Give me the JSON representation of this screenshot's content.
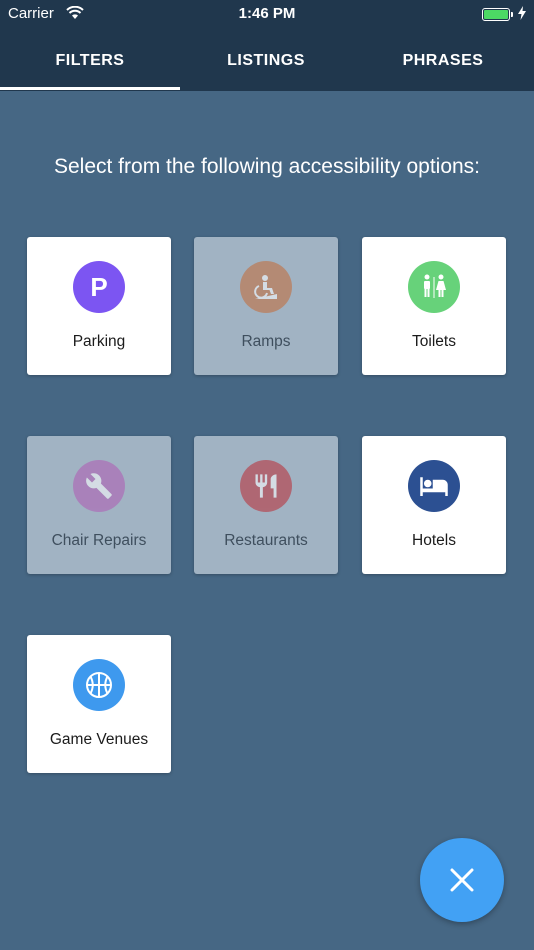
{
  "status_bar": {
    "carrier": "Carrier",
    "time": "1:46 PM"
  },
  "tabs": [
    {
      "label": "FILTERS",
      "active": true
    },
    {
      "label": "LISTINGS",
      "active": false
    },
    {
      "label": "PHRASES",
      "active": false
    }
  ],
  "heading": "Select from the following accessibility options:",
  "filters": [
    {
      "label": "Parking",
      "icon": "parking-icon",
      "color": "#7c55f2",
      "selected": true
    },
    {
      "label": "Ramps",
      "icon": "ramp-icon",
      "color": "#c56a35",
      "selected": false
    },
    {
      "label": "Toilets",
      "icon": "toilets-icon",
      "color": "#67d27a",
      "selected": true
    },
    {
      "label": "Chair Repairs",
      "icon": "wrench-icon",
      "color": "#b05ab4",
      "selected": false
    },
    {
      "label": "Restaurants",
      "icon": "restaurant-icon",
      "color": "#bb2a33",
      "selected": false
    },
    {
      "label": "Hotels",
      "icon": "bed-icon",
      "color": "#2c5092",
      "selected": true
    },
    {
      "label": "Game Venues",
      "icon": "basketball-icon",
      "color": "#3e99ee",
      "selected": true
    }
  ],
  "fab": {
    "icon": "close-icon",
    "color": "#42a1f4"
  },
  "colors": {
    "background": "#466784",
    "header": "#20374d",
    "card_off": "#a1b3c3"
  }
}
